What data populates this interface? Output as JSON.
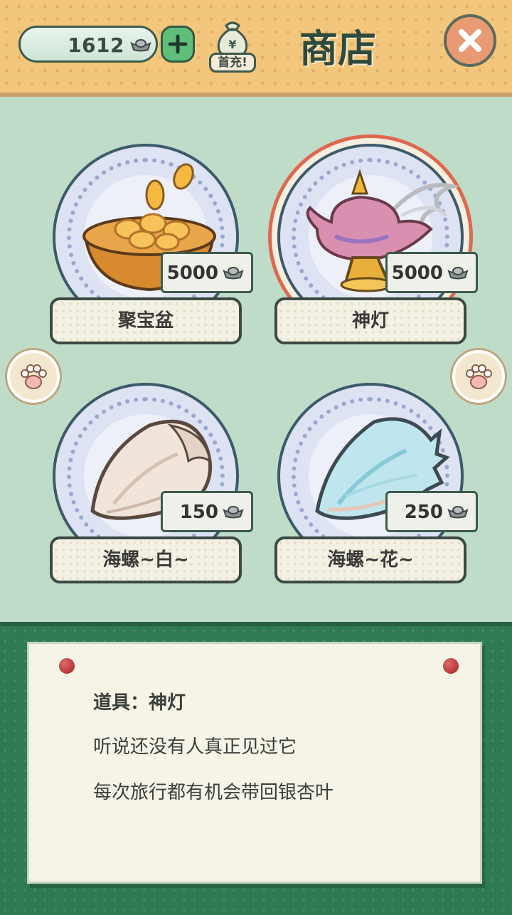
{
  "header": {
    "currency_value": "1612",
    "first_charge_label": "首充!",
    "title": "商店"
  },
  "items": [
    {
      "name": "聚宝盆",
      "price": "5000",
      "art": "treasure-bowl",
      "selected": false
    },
    {
      "name": "神灯",
      "price": "5000",
      "art": "magic-lamp",
      "selected": true
    },
    {
      "name": "海螺~白~",
      "price": "150",
      "art": "white-conch",
      "selected": false
    },
    {
      "name": "海螺~花~",
      "price": "250",
      "art": "flower-conch",
      "selected": false
    }
  ],
  "info": {
    "title": "道具：神灯",
    "line1": "听说还没有人真正见过它",
    "line2": "每次旅行都有机会带回银杏叶"
  },
  "colors": {
    "header_bg": "#f2c67c",
    "shop_bg": "#bfdcc9",
    "bottom_bg": "#2f7a52",
    "selected_ring": "#e0674f",
    "add_button": "#5fbf7a",
    "close_button": "#e89a72"
  },
  "icons": [
    "ingot-icon",
    "plus-icon",
    "money-bag-icon",
    "close-icon",
    "paw-icon"
  ]
}
